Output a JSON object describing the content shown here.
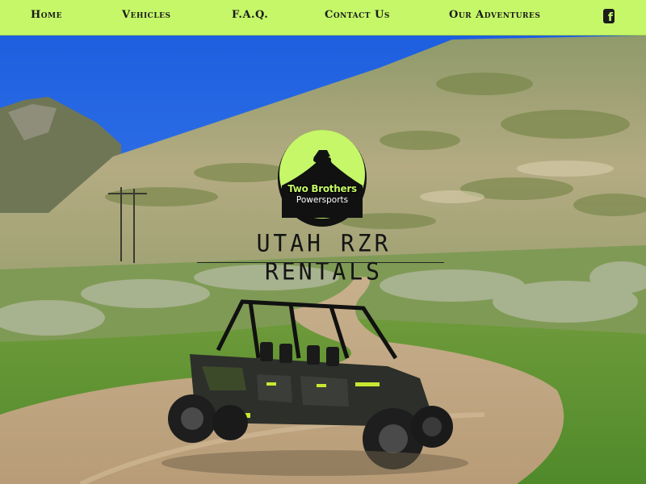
{
  "nav": {
    "items": [
      {
        "label": "Home"
      },
      {
        "label": "Vehicles"
      },
      {
        "label": "F.A.Q."
      },
      {
        "label": "Contact Us"
      },
      {
        "label": "Our Adventures"
      }
    ],
    "social_icon": "facebook-icon"
  },
  "logo": {
    "line1": "Two Brothers",
    "line2": "Powersports",
    "icon": "utv-on-hill-icon"
  },
  "hero": {
    "title": "UTAH RZR RENTALS",
    "image": "utv-on-dirt-trail-photo"
  },
  "colors": {
    "accent": "#c5f768",
    "text": "#1b1b1b",
    "sky": "#2f6fe0"
  }
}
